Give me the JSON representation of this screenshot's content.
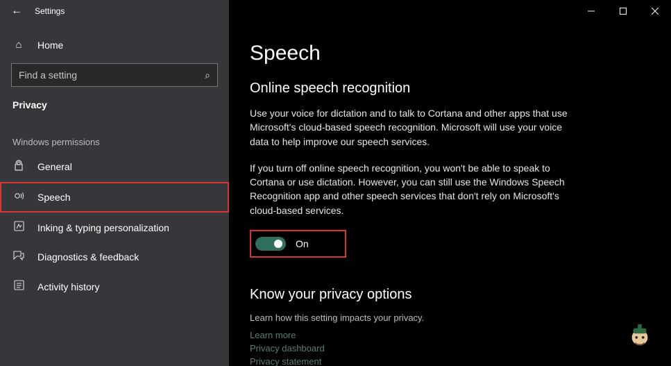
{
  "titlebar": {
    "app_title": "Settings"
  },
  "sidebar": {
    "home_label": "Home",
    "search_placeholder": "Find a setting",
    "category_label": "Privacy",
    "group_label": "Windows permissions",
    "items": [
      {
        "label": "General"
      },
      {
        "label": "Speech"
      },
      {
        "label": "Inking & typing personalization"
      },
      {
        "label": "Diagnostics & feedback"
      },
      {
        "label": "Activity history"
      }
    ]
  },
  "main": {
    "page_title": "Speech",
    "section_title": "Online speech recognition",
    "para1": "Use your voice for dictation and to talk to Cortana and other apps that use Microsoft's cloud-based speech recognition. Microsoft will use your voice data to help improve our speech services.",
    "para2": "If you turn off online speech recognition, you won't be able to speak to Cortana or use dictation. However, you can still use the Windows Speech Recognition app and other speech services that don't rely on Microsoft's cloud-based services.",
    "toggle_state": "On",
    "privacy_options_title": "Know your privacy options",
    "privacy_options_sub": "Learn how this setting impacts your privacy.",
    "links": {
      "learn_more": "Learn more",
      "dashboard": "Privacy dashboard",
      "statement": "Privacy statement"
    }
  }
}
